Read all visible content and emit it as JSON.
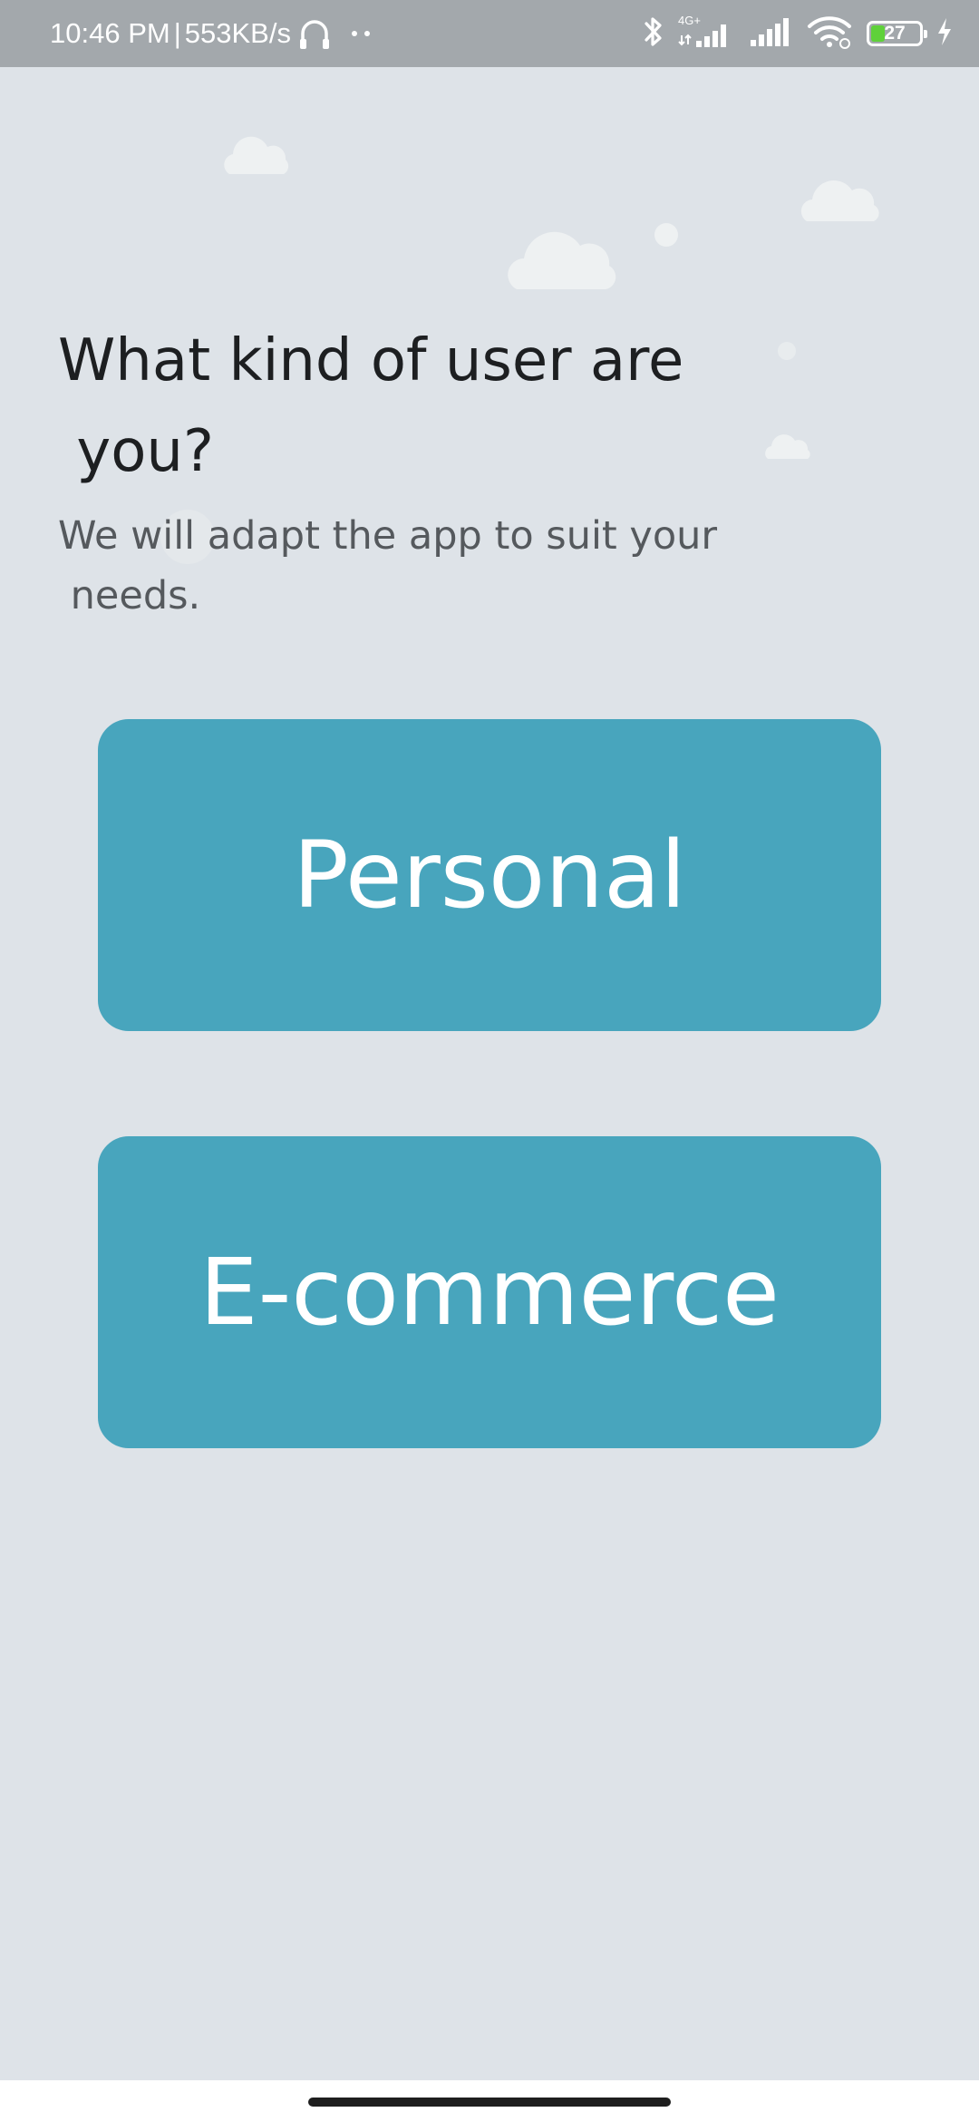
{
  "status_bar": {
    "time": "10:46 PM",
    "separator": "|",
    "net_speed": "553KB/s",
    "network_type": "4G+",
    "battery_level": "27",
    "icons": [
      "headphones-icon",
      "more-dots-icon",
      "bluetooth-icon",
      "signal-4g-icon",
      "signal-icon",
      "wifi-icon",
      "battery-icon",
      "charging-icon"
    ]
  },
  "onboarding": {
    "title": "What kind of user are\n you?",
    "subtitle": "We will adapt the app to suit your\n needs."
  },
  "choices": {
    "personal_label": "Personal",
    "ecommerce_label": "E-commerce"
  },
  "colors": {
    "background": "#dee3e8",
    "button": "#48a5bd",
    "status_bar": "#a3a8ac",
    "title_text": "#1d1f21",
    "subtitle_text": "#55595d"
  }
}
